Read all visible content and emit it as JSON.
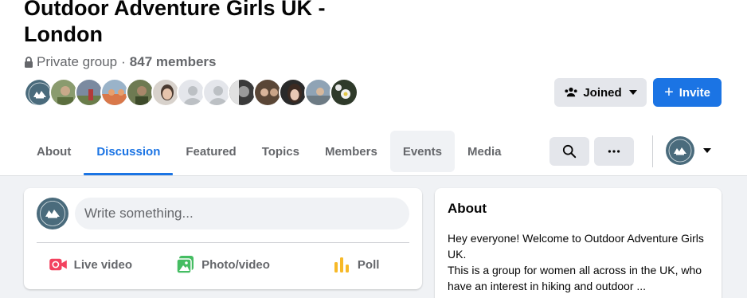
{
  "group": {
    "name": "Outdoor Adventure Girls UK - London",
    "privacy": "Private group",
    "separator": "·",
    "members": "847 members"
  },
  "actions": {
    "joined_label": "Joined",
    "invite_label": "Invite",
    "invite_prefix": "+"
  },
  "tabs": [
    {
      "label": "About",
      "active": false
    },
    {
      "label": "Discussion",
      "active": true
    },
    {
      "label": "Featured",
      "active": false
    },
    {
      "label": "Topics",
      "active": false
    },
    {
      "label": "Members",
      "active": false
    },
    {
      "label": "Events",
      "active": false
    },
    {
      "label": "Media",
      "active": false
    }
  ],
  "toolbar": {
    "search_icon": "search-icon",
    "more_icon": "more-options-icon"
  },
  "composer": {
    "placeholder": "Write something...",
    "live_video_label": "Live video",
    "photo_video_label": "Photo/video",
    "poll_label": "Poll"
  },
  "about": {
    "title": "About",
    "line1": "Hey everyone! Welcome to Outdoor Adventure Girls UK.",
    "line2": "This is a group for women all across in the UK, who have an interest in hiking and outdoor ..."
  },
  "colors": {
    "accent": "#1b74e4",
    "live": "#f3425f",
    "photo": "#45bd62",
    "poll": "#f7b928",
    "logo": "#4a6b7c"
  }
}
